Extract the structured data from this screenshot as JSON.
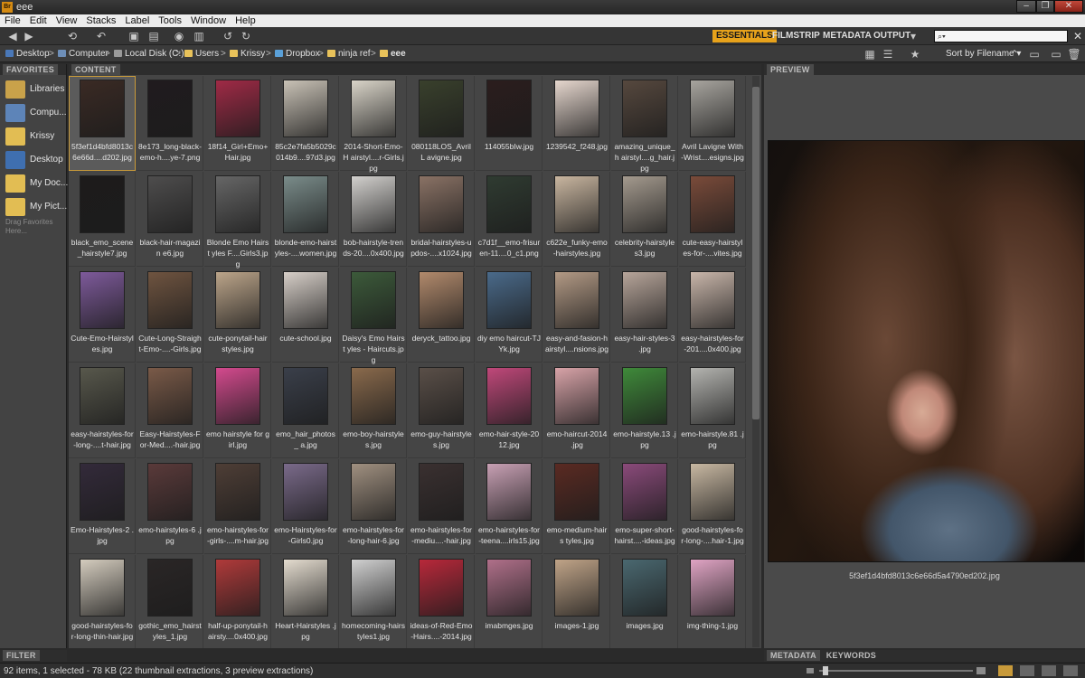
{
  "window": {
    "title": "eee",
    "app_badge": "Br"
  },
  "menu": [
    "File",
    "Edit",
    "View",
    "Stacks",
    "Label",
    "Tools",
    "Window",
    "Help"
  ],
  "workspaces": {
    "essentials": "ESSENTIALS",
    "filmstrip": "FILMSTRIP",
    "metadata": "METADATA",
    "output": "OUTPUT"
  },
  "search": {
    "placeholder": ""
  },
  "breadcrumb": [
    "Desktop",
    "Computer",
    "Local Disk (C:)",
    "Users",
    "Krissy",
    "Dropbox",
    "ninja ref",
    "eee"
  ],
  "sort": {
    "label": "Sort by Filename"
  },
  "panels": {
    "favorites": "FAVORITES",
    "content": "CONTENT",
    "preview": "PREVIEW",
    "filter": "FILTER",
    "metadata": "METADATA",
    "keywords": "KEYWORDS"
  },
  "favorites": [
    {
      "label": "Libraries",
      "color": "#c9a24a"
    },
    {
      "label": "Compu...",
      "color": "#5d84b8"
    },
    {
      "label": "Krissy",
      "color": "#e2bd53"
    },
    {
      "label": "Desktop",
      "color": "#3f6fb0"
    },
    {
      "label": "My Doc...",
      "color": "#e2bd53"
    },
    {
      "label": "My Pict...",
      "color": "#e2bd53"
    }
  ],
  "favorites_hint": "Drag Favorites Here...",
  "files": [
    {
      "name": "5f3ef1d4bfd8013c 6e66d....d202.jpg",
      "c": "#3a2a24"
    },
    {
      "name": "8e173_long-black- emo-h....ye-7.png",
      "c": "#201b1e"
    },
    {
      "name": "18f14_Girl+Emo+ Hair.jpg",
      "c": "#a02a46"
    },
    {
      "name": "85c2e7fa5b5029c 014b9....97d3.jpg",
      "c": "#c9c2b6"
    },
    {
      "name": "2014-Short-Emo-H airstyl....r-Girls.jpg",
      "c": "#d9d4c8"
    },
    {
      "name": "080118LOS_AvrilL avigne.jpg",
      "c": "#39402c"
    },
    {
      "name": "114055bIw.jpg",
      "c": "#2b1d1d"
    },
    {
      "name": "1239542_f248.jpg",
      "c": "#e6d7ce"
    },
    {
      "name": "amazing_unique_h airstyl....g_hair.jpg",
      "c": "#56483e"
    },
    {
      "name": "Avril Lavigne With -Wrist....esigns.jpg",
      "c": "#a8a59f"
    },
    {
      "name": "black_emo_scene _hairstyle7.jpg",
      "c": "#1d1b1b"
    },
    {
      "name": "black-hair-magazin e6.jpg",
      "c": "#4e4d4d"
    },
    {
      "name": "Blonde Emo Hairst yles F....Girls3.jpg",
      "c": "#666666"
    },
    {
      "name": "blonde-emo-hairst yles-....women.jpg",
      "c": "#7a8c8a"
    },
    {
      "name": "bob-hairstyle-tren ds-20....0x400.jpg",
      "c": "#d2d0cd"
    },
    {
      "name": "bridal-hairstyles-u pdos-....x1024.jpg",
      "c": "#8a7265"
    },
    {
      "name": "c7d1f__emo-frisur en-11....0_c1.png",
      "c": "#2f3b31"
    },
    {
      "name": "c622e_funky-emo -hairstyles.jpg",
      "c": "#c9b6a0"
    },
    {
      "name": "celebrity-hairstyle s3.jpg",
      "c": "#a49a8e"
    },
    {
      "name": "cute-easy-hairstyl es-for-....vites.jpg",
      "c": "#7a4b3a"
    },
    {
      "name": "Cute-Emo-Hairstyl es.jpg",
      "c": "#7e5a9b"
    },
    {
      "name": "Cute-Long-Straigh t-Emo-....-Girls.jpg",
      "c": "#6f5440"
    },
    {
      "name": "cute-ponytail-hair styles.jpg",
      "c": "#bca58a"
    },
    {
      "name": "cute-school.jpg",
      "c": "#d7cfc8"
    },
    {
      "name": "Daisy's Emo Hairst yles - Haircuts.jpg",
      "c": "#3c5a3a"
    },
    {
      "name": "deryck_tattoo.jpg",
      "c": "#b28a6c"
    },
    {
      "name": "diy emo haircut-TJ Yk.jpg",
      "c": "#4a6a8a"
    },
    {
      "name": "easy-and-fasion-h airstyl....nsions.jpg",
      "c": "#b39a85"
    },
    {
      "name": "easy-hair-styles-3 .jpg",
      "c": "#b7a59a"
    },
    {
      "name": "easy-hairstyles-for -201....0x400.jpg",
      "c": "#c9b6aa"
    },
    {
      "name": "easy-hairstyles-for -long-....t-hair.jpg",
      "c": "#58584c"
    },
    {
      "name": "Easy-Hairstyles-F or-Med....-hair.jpg",
      "c": "#7a5a48"
    },
    {
      "name": "emo hairstyle for girl.jpg",
      "c": "#d44a8e"
    },
    {
      "name": "emo_hair_photos_ a.jpg",
      "c": "#3a3f4a"
    },
    {
      "name": "emo-boy-hairstyle s.jpg",
      "c": "#8a6a4c"
    },
    {
      "name": "emo-guy-hairstyle s.jpg",
      "c": "#5a4f48"
    },
    {
      "name": "emo-hair-style-20 12.jpg",
      "c": "#c0487a"
    },
    {
      "name": "emo-haircut-2014 .jpg",
      "c": "#d8a3a8"
    },
    {
      "name": "emo-hairstyle.13 .jpg",
      "c": "#3f8a3a"
    },
    {
      "name": "emo-hairstyle.81 .jpg",
      "c": "#b4b4b0"
    },
    {
      "name": "Emo-Hairstyles-2 .jpg",
      "c": "#332a3a"
    },
    {
      "name": "emo-hairstyles-6 .jpg",
      "c": "#5a3a3a"
    },
    {
      "name": "emo-hairstyles-for -girls-....m-hair.jpg",
      "c": "#4e3e36"
    },
    {
      "name": "emo-Hairstyles-for -Girls0.jpg",
      "c": "#7a6a8a"
    },
    {
      "name": "emo-hairstyles-for -long-hair-6.jpg",
      "c": "#a09080"
    },
    {
      "name": "emo-hairstyles-for -mediu....-hair.jpg",
      "c": "#3a3030"
    },
    {
      "name": "emo-hairstyles-for -teena....irls15.jpg",
      "c": "#c8a0b4"
    },
    {
      "name": "emo-medium-hairs tyles.jpg",
      "c": "#5a2a22"
    },
    {
      "name": "emo-super-short- hairst....-ideas.jpg",
      "c": "#8a4a7a"
    },
    {
      "name": "good-hairstyles-fo r-long-....hair-1.jpg",
      "c": "#c8b8a2"
    },
    {
      "name": "good-hairstyles-fo r-long-thin-hair.jpg",
      "c": "#d4ccbe"
    },
    {
      "name": "gothic_emo_hairst yles_1.jpg",
      "c": "#2a2626"
    },
    {
      "name": "half-up-ponytail-h airsty....0x400.jpg",
      "c": "#b03a3a"
    },
    {
      "name": "Heart-Hairstyles .jpg",
      "c": "#e4dccf"
    },
    {
      "name": "homecoming-hairs tyles1.jpg",
      "c": "#d0d0d0"
    },
    {
      "name": "ideas-of-Red-Emo -Hairs....-2014.jpg",
      "c": "#b8283a"
    },
    {
      "name": "imabmges.jpg",
      "c": "#b0708a"
    },
    {
      "name": "images-1.jpg",
      "c": "#c0a488"
    },
    {
      "name": "images.jpg",
      "c": "#4a6870"
    },
    {
      "name": "img-thing-1.jpg",
      "c": "#e0a4c4"
    }
  ],
  "preview_caption": "5f3ef1d4bfd8013c6e66d5a4790ed202.jpg",
  "status": "92 items, 1 selected - 78 KB (22 thumbnail extractions, 3 preview extractions)"
}
